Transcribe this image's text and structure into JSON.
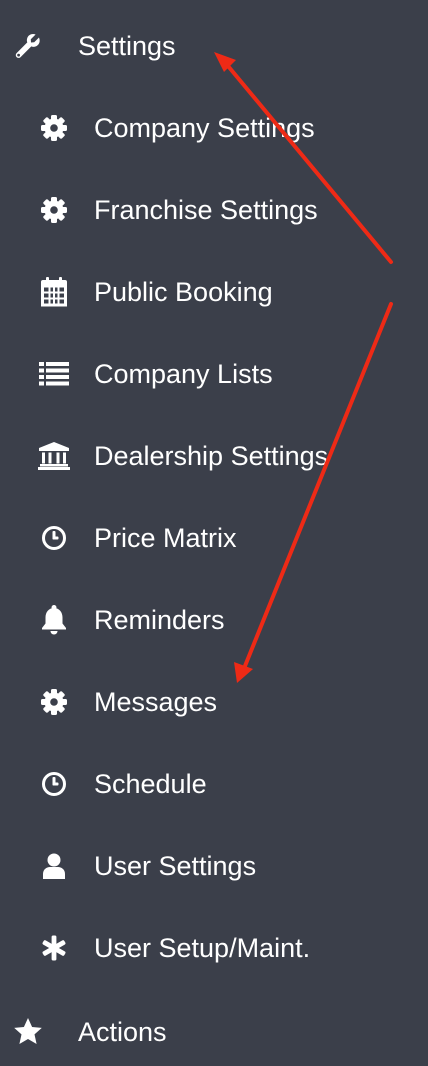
{
  "nav": {
    "settings": {
      "label": "Settings",
      "icon": "wrench-icon"
    },
    "items": [
      {
        "label": "Company Settings",
        "icon": "gear-icon"
      },
      {
        "label": "Franchise Settings",
        "icon": "gear-icon"
      },
      {
        "label": "Public Booking",
        "icon": "calendar-icon"
      },
      {
        "label": "Company Lists",
        "icon": "list-icon"
      },
      {
        "label": "Dealership Settings",
        "icon": "bank-icon"
      },
      {
        "label": "Price Matrix",
        "icon": "clock-icon"
      },
      {
        "label": "Reminders",
        "icon": "bell-icon"
      },
      {
        "label": "Messages",
        "icon": "gear-icon"
      },
      {
        "label": "Schedule",
        "icon": "clock-icon"
      },
      {
        "label": "User Settings",
        "icon": "user-icon"
      },
      {
        "label": "User Setup/Maint.",
        "icon": "asterisk-icon"
      }
    ],
    "actions": {
      "label": "Actions",
      "icon": "star-icon"
    }
  },
  "colors": {
    "background": "#3b3f4a",
    "text": "#ffffff",
    "annotation_arrow": "#ee2a16"
  }
}
